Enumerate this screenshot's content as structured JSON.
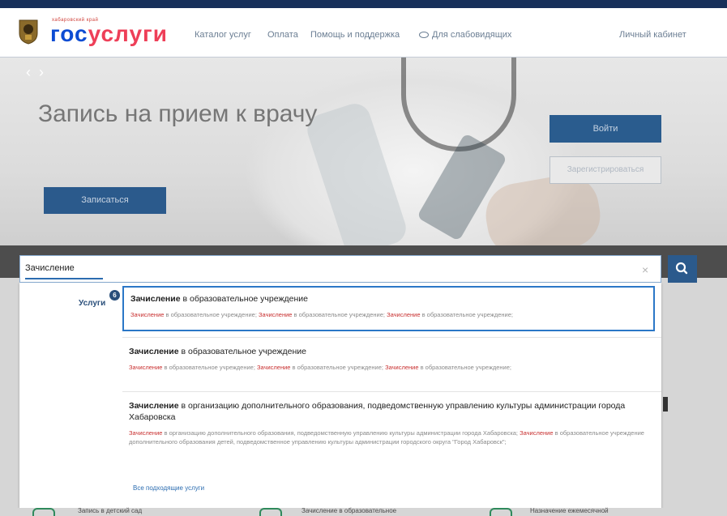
{
  "header": {
    "region_label": "хабаровский край",
    "logo_part1": "гос",
    "logo_part2": "услуги",
    "nav": {
      "catalog": "Каталог услуг",
      "payment": "Оплата",
      "help": "Помощь и поддержка",
      "accessibility": "Для слабовидящих",
      "cabinet": "Личный кабинет"
    }
  },
  "hero": {
    "title": "Запись на прием к врачу",
    "signup_button": "Записаться",
    "login_button": "Войти",
    "register_button": "Зарегистрироваться"
  },
  "search": {
    "value": "Зачисление"
  },
  "results": {
    "category_label": "Услуги",
    "category_count": "6",
    "items": [
      {
        "title_bold": "Зачисление",
        "title_rest": " в образовательное учреждение",
        "desc_parts": [
          {
            "hl": "Зачисление",
            "text": " в образовательное учреждение; "
          },
          {
            "hl": "Зачисление",
            "text": " в образовательное учреждение; "
          },
          {
            "hl": "Зачисление",
            "text": " в образовательное учреждение;"
          }
        ]
      },
      {
        "title_bold": "Зачисление",
        "title_rest": " в образовательное учреждение",
        "desc_parts": [
          {
            "hl": "Зачисление",
            "text": " в образовательное учреждение; "
          },
          {
            "hl": "Зачисление",
            "text": " в образовательное учреждение; "
          },
          {
            "hl": "Зачисление",
            "text": " в образовательное учреждение;"
          }
        ]
      },
      {
        "title_bold": "Зачисление",
        "title_rest": " в организацию дополнительного образования, подведомственную управлению культуры администрации города Хабаровска",
        "desc_parts": [
          {
            "hl": "Зачисление",
            "text": " в организацию дополнительного образования, подведомственную управлению культуры администрации города Хабаровска; "
          },
          {
            "hl": "Зачисление",
            "text": " в образовательное учреждение дополнительного образования детей, подведомственное управлению культуры администрации городского округа \"Город Хабаровск\";"
          }
        ]
      }
    ],
    "all_link": "Все подходящие услуги"
  },
  "bottom": {
    "item1": "Запись в детский сад",
    "item2": "Зачисление в образовательное",
    "item3": "Назначение ежемесячной"
  },
  "colors": {
    "brand_blue": "#0d4cd3",
    "brand_red": "#ee3f58",
    "button_blue": "#2b5a8c",
    "highlight_red": "#c82f2f",
    "selection_border": "#2b77c7"
  }
}
